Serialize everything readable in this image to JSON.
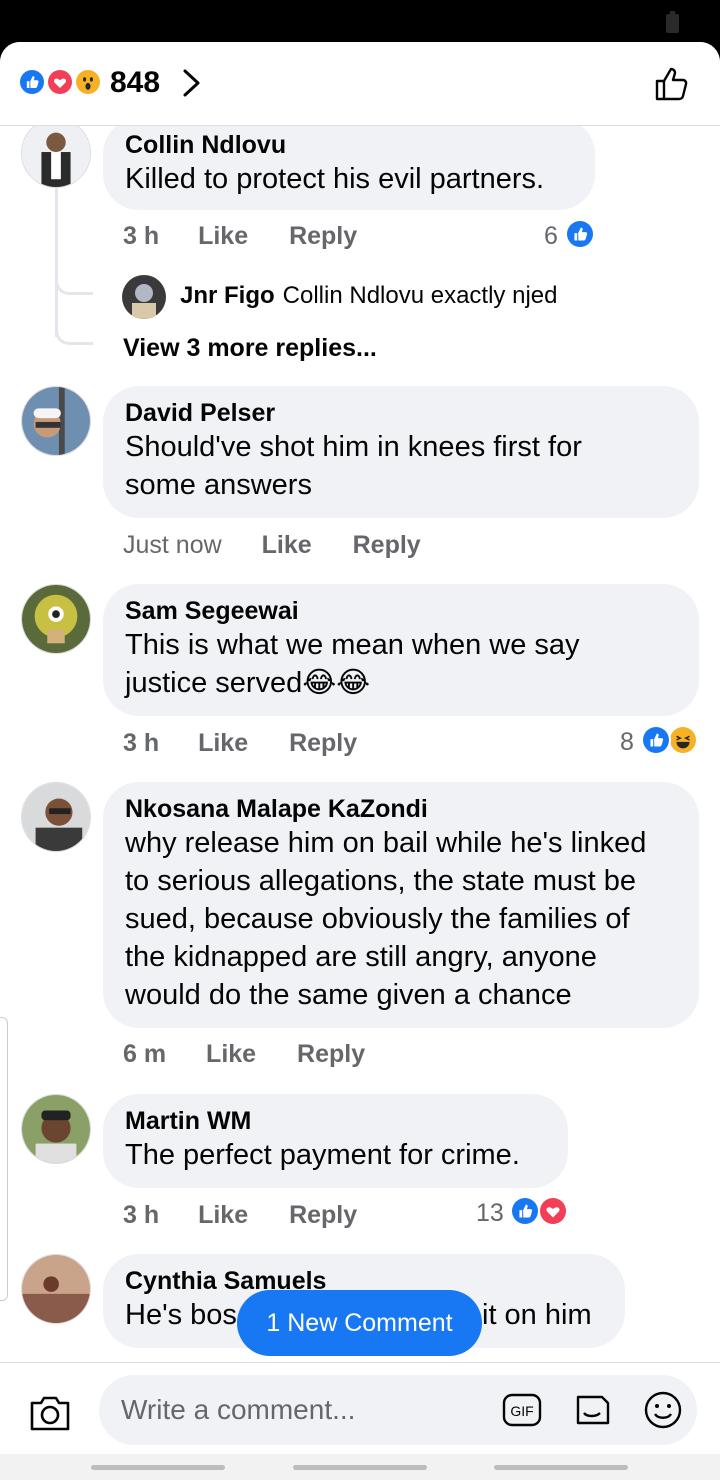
{
  "header": {
    "reaction_count": "848",
    "reactions": [
      "like-icon",
      "love-icon",
      "wow-icon"
    ]
  },
  "comments": [
    {
      "name": "Collin Ndlovu",
      "text": "Killed to protect his evil partners.",
      "time": "3 h",
      "like": "Like",
      "reply": "Reply",
      "count": "6",
      "reactions": [
        "like-icon"
      ]
    },
    {
      "name": "David Pelser",
      "text": "Should've shot him in knees first for some answers",
      "time": "Just now",
      "like": "Like",
      "reply": "Reply"
    },
    {
      "name": "Sam Segeewai",
      "text": "This is what we mean when we say justice served",
      "emoji": "😂😂",
      "time": "3 h",
      "like": "Like",
      "reply": "Reply",
      "count": "8",
      "reactions": [
        "like-icon",
        "haha-icon"
      ]
    },
    {
      "name": "Nkosana Malape KaZondi",
      "text": "why release him on bail while he's linked to serious allegations, the state must be sued, because obviously the families of the kidnapped are still angry, anyone would do the same given a chance",
      "time": "6 m",
      "like": "Like",
      "reply": "Reply"
    },
    {
      "name": "Martin WM",
      "text": "The perfect payment for crime.",
      "time": "3 h",
      "like": "Like",
      "reply": "Reply",
      "count": "13",
      "reactions": [
        "like-icon",
        "love-icon"
      ]
    },
    {
      "name": "Cynthia Samuels",
      "text_left": "He's bos",
      "text_right": "it on him"
    }
  ],
  "reply_preview": {
    "name": "Jnr Figo",
    "text": "Collin Ndlovu exactly njed",
    "more": "View 3 more replies..."
  },
  "new_comment": "1 New Comment",
  "composer": {
    "placeholder": "Write a comment...",
    "gif": "GIF"
  },
  "colors": {
    "accent": "#1877f2",
    "love": "#f33e58",
    "bubble": "#f0f2f5",
    "meta": "#65676b"
  }
}
